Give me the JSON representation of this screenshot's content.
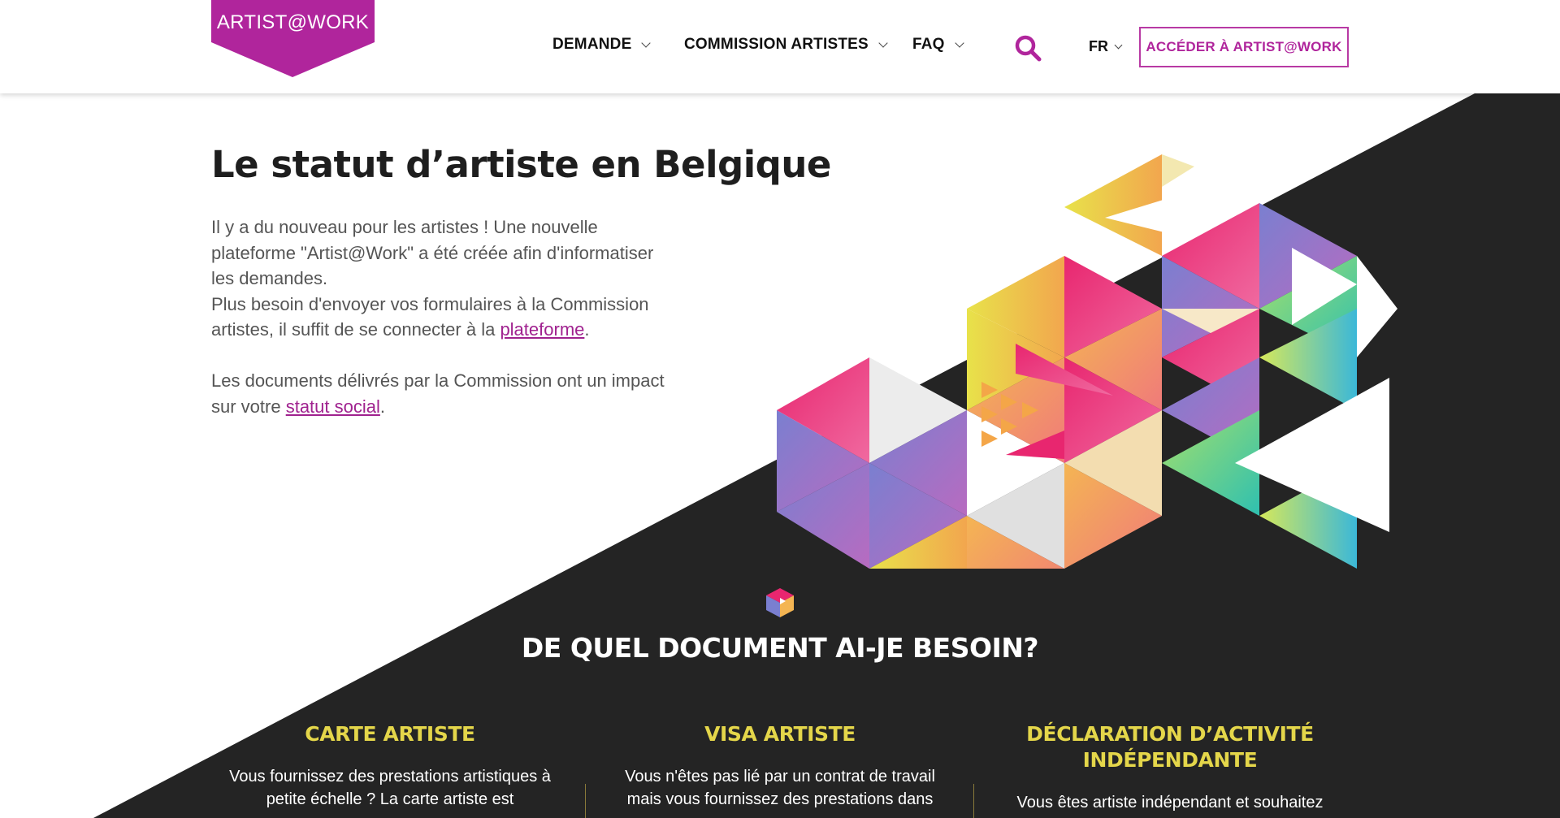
{
  "header": {
    "logo": "ARTIST@WORK",
    "nav": [
      {
        "label": "DEMANDE"
      },
      {
        "label": "COMMISSION ARTISTES"
      },
      {
        "label": "FAQ"
      }
    ],
    "search_icon": "search-icon",
    "lang": "FR",
    "cta": "ACCÉDER À ARTIST@WORK"
  },
  "hero": {
    "title": "Le statut d’artiste en Belgique",
    "p1_a": "Il y a du nouveau pour les artistes ! Une nouvelle plateforme \"Artist@Work\" a été créée afin d'informatiser les demandes.",
    "p1_b": "Plus besoin d'envoyer vos formulaires à la Commission artistes, il suffit de se connecter à la ",
    "p1_link": "plateforme",
    "p1_end": ".",
    "p2_a": "Les documents délivrés par la Commission ont un impact sur votre ",
    "p2_link": "statut social",
    "p2_end": "."
  },
  "section": {
    "title": "DE QUEL DOCUMENT AI-JE BESOIN?",
    "columns": [
      {
        "title": "CARTE ARTISTE",
        "text": "Vous fournissez des prestations artistiques à petite échelle ? La carte artiste est"
      },
      {
        "title": "VISA ARTISTE",
        "text": "Vous n'êtes pas lié par un contrat de travail mais vous fournissez des prestations dans"
      },
      {
        "title": "DÉCLARATION D’ACTIVITÉ INDÉPENDANTE",
        "text": "Vous êtes artiste indépendant et souhaitez"
      }
    ]
  },
  "colors": {
    "brand": "#b0259c",
    "dark": "#242424",
    "accent_yellow": "#e4d64a"
  }
}
